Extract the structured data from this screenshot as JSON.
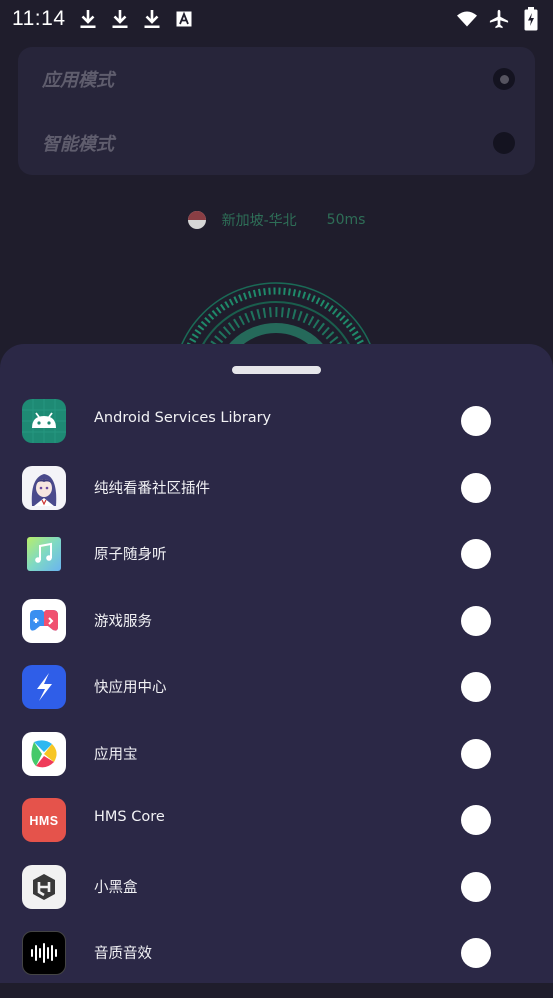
{
  "status_bar": {
    "time": "11:14",
    "left_icons": [
      "download-icon",
      "download-icon",
      "download-icon",
      "text-notification-icon"
    ],
    "right_icons": [
      "wifi-icon",
      "airplane-mode-icon",
      "battery-charging-icon"
    ]
  },
  "mode_card": {
    "options": [
      {
        "label": "应用模式",
        "selected": true
      },
      {
        "label": "智能模式",
        "selected": false
      }
    ]
  },
  "server": {
    "flag_icon": "singapore-flag-icon",
    "name": "新加坡-华北",
    "ping": "50ms"
  },
  "apps": [
    {
      "name": "Android Services Library",
      "icon": "android-icon",
      "selected": false
    },
    {
      "name": "纯纯看番社区插件",
      "icon": "anime-avatar-icon",
      "selected": false
    },
    {
      "name": "原子随身听",
      "icon": "music-note-icon",
      "selected": false
    },
    {
      "name": "游戏服务",
      "icon": "gamepad-icon",
      "selected": false
    },
    {
      "name": "快应用中心",
      "icon": "lightning-icon",
      "selected": false
    },
    {
      "name": "应用宝",
      "icon": "colorful-petal-icon",
      "selected": false
    },
    {
      "name": "HMS Core",
      "icon": "hms-icon",
      "selected": false
    },
    {
      "name": "小黑盒",
      "icon": "hexagon-box-icon",
      "selected": false
    },
    {
      "name": "音质音效",
      "icon": "sound-wave-icon",
      "selected": false
    }
  ],
  "colors": {
    "background": "#1f1d2c",
    "card": "#27253a",
    "sheet": "#2b2846",
    "server_text": "#2e6e57",
    "gauge": "#1f8a6a"
  }
}
